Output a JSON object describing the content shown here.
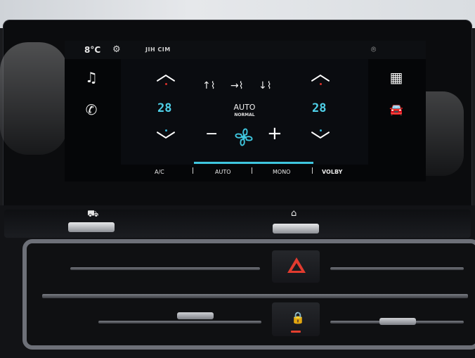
{
  "status_bar": {
    "outside_temp": "8°C",
    "settings_icon": "gear-icon",
    "radio_station": "JIH CIM",
    "location_icon": "location-pin-icon"
  },
  "left_sidebar": [
    {
      "icon": "music-note-icon",
      "glyph": "♫"
    },
    {
      "icon": "phone-icon",
      "glyph": "✆"
    }
  ],
  "right_sidebar": [
    {
      "icon": "apps-grid-icon",
      "glyph": "▦"
    },
    {
      "icon": "car-icon",
      "glyph": "🚘"
    }
  ],
  "climate": {
    "left_temp": "28",
    "right_temp": "28",
    "mode_label": "AUTO",
    "mode_sub": "NORMAL",
    "fan_minus": "−",
    "fan_plus": "+"
  },
  "bottom_tabs": [
    {
      "label": "A/C"
    },
    {
      "label": "AUTO"
    },
    {
      "label": "MONO"
    },
    {
      "label": "VOLBY"
    }
  ],
  "airflow_modes": [
    {
      "icon": "airflow-up-icon",
      "glyph": "↑⌇"
    },
    {
      "icon": "airflow-center-icon",
      "glyph": "→⌇"
    },
    {
      "icon": "airflow-down-icon",
      "glyph": "↓⌇"
    }
  ],
  "colors": {
    "temp_accent": "#4fd0e8",
    "hot_indicator": "#d9312b",
    "cold_indicator": "#34b3d3",
    "hazard": "#e23b2f"
  },
  "physical_buttons": {
    "left_icon": "car-icon",
    "right_icon": "home-icon",
    "hazard_icon": "hazard-triangle-icon",
    "lock_icon": "door-lock-icon"
  }
}
